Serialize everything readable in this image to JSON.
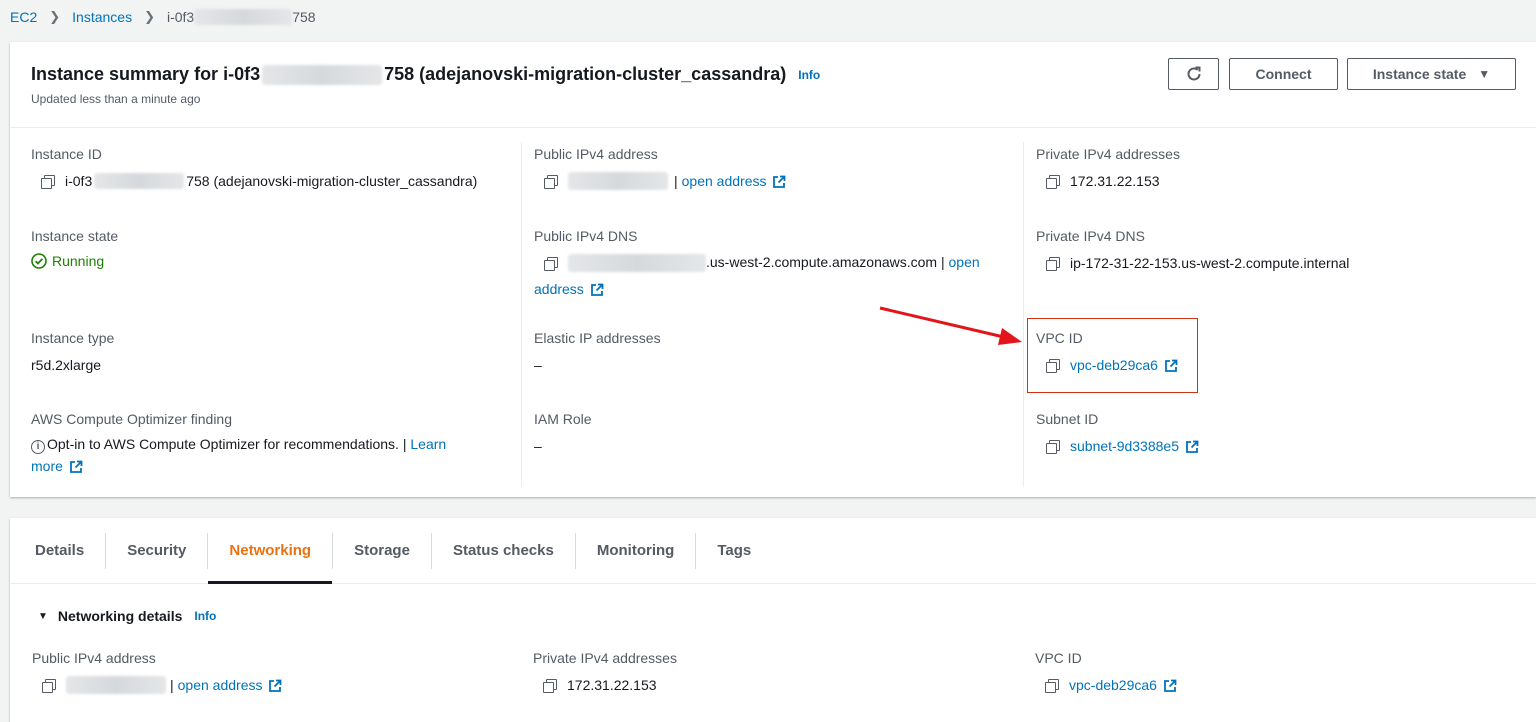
{
  "breadcrumb": {
    "root": "EC2",
    "section": "Instances",
    "current_prefix": "i-0f3",
    "current_suffix": "758"
  },
  "summary": {
    "title_prefix": "Instance summary for i-0f3",
    "title_suffix": "758 (adejanovski-migration-cluster_cassandra)",
    "info": "Info",
    "updated": "Updated less than a minute ago",
    "buttons": {
      "connect": "Connect",
      "instance_state": "Instance state"
    }
  },
  "fields": {
    "instance_id": {
      "label": "Instance ID",
      "prefix": "i-0f3",
      "suffix": "758 (adejanovski-migration-cluster_cassandra)"
    },
    "public_ipv4": {
      "label": "Public IPv4 address",
      "sep": "|",
      "link": "open address"
    },
    "private_ipv4": {
      "label": "Private IPv4 addresses",
      "value": "172.31.22.153"
    },
    "instance_state": {
      "label": "Instance state",
      "value": "Running"
    },
    "public_dns": {
      "label": "Public IPv4 DNS",
      "suffix": ".us-west-2.compute.amazonaws.com",
      "sep": "|",
      "link_a": "open",
      "link_b": "address"
    },
    "private_dns": {
      "label": "Private IPv4 DNS",
      "value": "ip-172-31-22-153.us-west-2.compute.internal"
    },
    "instance_type": {
      "label": "Instance type",
      "value": "r5d.2xlarge"
    },
    "elastic_ip": {
      "label": "Elastic IP addresses",
      "value": "–"
    },
    "vpc_id": {
      "label": "VPC ID",
      "value": "vpc-deb29ca6"
    },
    "optimizer": {
      "label": "AWS Compute Optimizer finding",
      "text": "Opt-in to AWS Compute Optimizer for recommendations.",
      "sep": "|",
      "link_a": "Learn",
      "link_b": "more"
    },
    "iam_role": {
      "label": "IAM Role",
      "value": "–"
    },
    "subnet_id": {
      "label": "Subnet ID",
      "value": "subnet-9d3388e5"
    }
  },
  "tabs": [
    {
      "label": "Details"
    },
    {
      "label": "Security"
    },
    {
      "label": "Networking"
    },
    {
      "label": "Storage"
    },
    {
      "label": "Status checks"
    },
    {
      "label": "Monitoring"
    },
    {
      "label": "Tags"
    }
  ],
  "active_tab": "Networking",
  "networking": {
    "heading": "Networking details",
    "info": "Info",
    "public_ipv4": {
      "label": "Public IPv4 address",
      "sep": "|",
      "link": "open address"
    },
    "private_ipv4": {
      "label": "Private IPv4 addresses",
      "value": "172.31.22.153"
    },
    "vpc_id": {
      "label": "VPC ID",
      "value": "vpc-deb29ca6"
    }
  },
  "colors": {
    "link": "#0073bb",
    "running": "#1d8102",
    "active_tab": "#ec7211",
    "highlight": "#d13212",
    "arrow": "#e4141b"
  }
}
